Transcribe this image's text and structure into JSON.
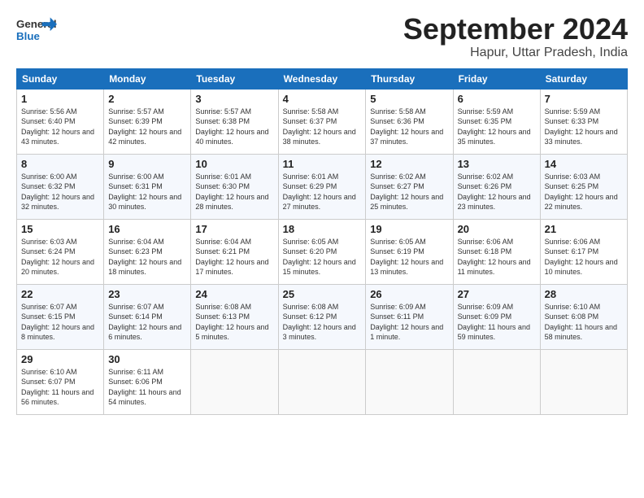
{
  "header": {
    "logo_general": "General",
    "logo_blue": "Blue",
    "month": "September 2024",
    "location": "Hapur, Uttar Pradesh, India"
  },
  "weekdays": [
    "Sunday",
    "Monday",
    "Tuesday",
    "Wednesday",
    "Thursday",
    "Friday",
    "Saturday"
  ],
  "weeks": [
    [
      {
        "day": "1",
        "sunrise": "5:56 AM",
        "sunset": "6:40 PM",
        "daylight": "12 hours and 43 minutes."
      },
      {
        "day": "2",
        "sunrise": "5:57 AM",
        "sunset": "6:39 PM",
        "daylight": "12 hours and 42 minutes."
      },
      {
        "day": "3",
        "sunrise": "5:57 AM",
        "sunset": "6:38 PM",
        "daylight": "12 hours and 40 minutes."
      },
      {
        "day": "4",
        "sunrise": "5:58 AM",
        "sunset": "6:37 PM",
        "daylight": "12 hours and 38 minutes."
      },
      {
        "day": "5",
        "sunrise": "5:58 AM",
        "sunset": "6:36 PM",
        "daylight": "12 hours and 37 minutes."
      },
      {
        "day": "6",
        "sunrise": "5:59 AM",
        "sunset": "6:35 PM",
        "daylight": "12 hours and 35 minutes."
      },
      {
        "day": "7",
        "sunrise": "5:59 AM",
        "sunset": "6:33 PM",
        "daylight": "12 hours and 33 minutes."
      }
    ],
    [
      {
        "day": "8",
        "sunrise": "6:00 AM",
        "sunset": "6:32 PM",
        "daylight": "12 hours and 32 minutes."
      },
      {
        "day": "9",
        "sunrise": "6:00 AM",
        "sunset": "6:31 PM",
        "daylight": "12 hours and 30 minutes."
      },
      {
        "day": "10",
        "sunrise": "6:01 AM",
        "sunset": "6:30 PM",
        "daylight": "12 hours and 28 minutes."
      },
      {
        "day": "11",
        "sunrise": "6:01 AM",
        "sunset": "6:29 PM",
        "daylight": "12 hours and 27 minutes."
      },
      {
        "day": "12",
        "sunrise": "6:02 AM",
        "sunset": "6:27 PM",
        "daylight": "12 hours and 25 minutes."
      },
      {
        "day": "13",
        "sunrise": "6:02 AM",
        "sunset": "6:26 PM",
        "daylight": "12 hours and 23 minutes."
      },
      {
        "day": "14",
        "sunrise": "6:03 AM",
        "sunset": "6:25 PM",
        "daylight": "12 hours and 22 minutes."
      }
    ],
    [
      {
        "day": "15",
        "sunrise": "6:03 AM",
        "sunset": "6:24 PM",
        "daylight": "12 hours and 20 minutes."
      },
      {
        "day": "16",
        "sunrise": "6:04 AM",
        "sunset": "6:23 PM",
        "daylight": "12 hours and 18 minutes."
      },
      {
        "day": "17",
        "sunrise": "6:04 AM",
        "sunset": "6:21 PM",
        "daylight": "12 hours and 17 minutes."
      },
      {
        "day": "18",
        "sunrise": "6:05 AM",
        "sunset": "6:20 PM",
        "daylight": "12 hours and 15 minutes."
      },
      {
        "day": "19",
        "sunrise": "6:05 AM",
        "sunset": "6:19 PM",
        "daylight": "12 hours and 13 minutes."
      },
      {
        "day": "20",
        "sunrise": "6:06 AM",
        "sunset": "6:18 PM",
        "daylight": "12 hours and 11 minutes."
      },
      {
        "day": "21",
        "sunrise": "6:06 AM",
        "sunset": "6:17 PM",
        "daylight": "12 hours and 10 minutes."
      }
    ],
    [
      {
        "day": "22",
        "sunrise": "6:07 AM",
        "sunset": "6:15 PM",
        "daylight": "12 hours and 8 minutes."
      },
      {
        "day": "23",
        "sunrise": "6:07 AM",
        "sunset": "6:14 PM",
        "daylight": "12 hours and 6 minutes."
      },
      {
        "day": "24",
        "sunrise": "6:08 AM",
        "sunset": "6:13 PM",
        "daylight": "12 hours and 5 minutes."
      },
      {
        "day": "25",
        "sunrise": "6:08 AM",
        "sunset": "6:12 PM",
        "daylight": "12 hours and 3 minutes."
      },
      {
        "day": "26",
        "sunrise": "6:09 AM",
        "sunset": "6:11 PM",
        "daylight": "12 hours and 1 minute."
      },
      {
        "day": "27",
        "sunrise": "6:09 AM",
        "sunset": "6:09 PM",
        "daylight": "11 hours and 59 minutes."
      },
      {
        "day": "28",
        "sunrise": "6:10 AM",
        "sunset": "6:08 PM",
        "daylight": "11 hours and 58 minutes."
      }
    ],
    [
      {
        "day": "29",
        "sunrise": "6:10 AM",
        "sunset": "6:07 PM",
        "daylight": "11 hours and 56 minutes."
      },
      {
        "day": "30",
        "sunrise": "6:11 AM",
        "sunset": "6:06 PM",
        "daylight": "11 hours and 54 minutes."
      },
      null,
      null,
      null,
      null,
      null
    ]
  ]
}
